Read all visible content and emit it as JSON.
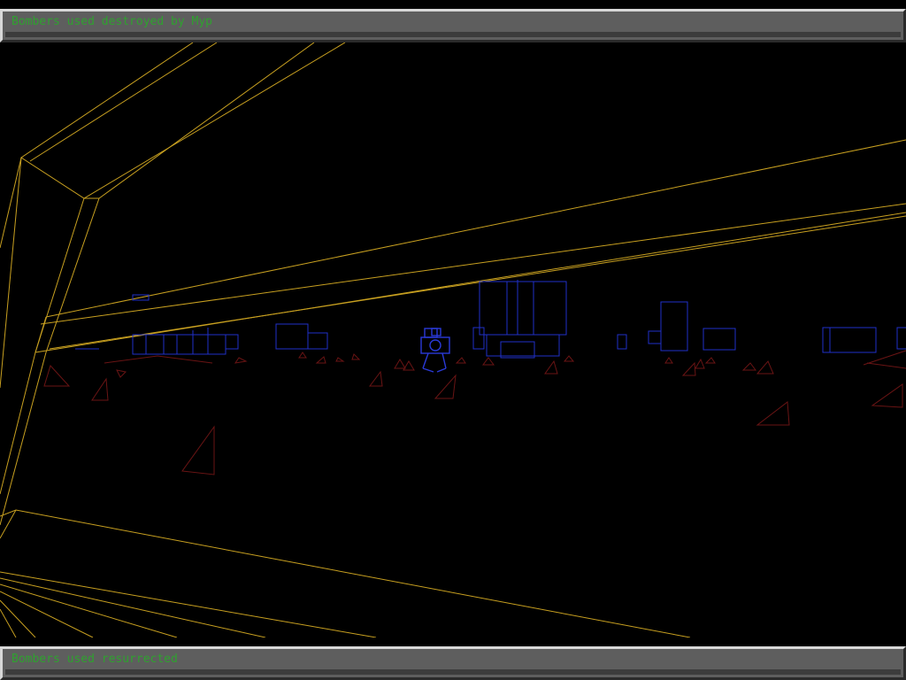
{
  "hud": {
    "top_message": "Bombers used destroyed by Myp",
    "bottom_message": "Bombers used resurrected"
  },
  "colors": {
    "background": "#000000",
    "wall_wireframe": "#c8a020",
    "building_wireframe": "#2030c8",
    "marker_wireframe": "#6a1414",
    "enemy_wireframe": "#2a3ad8",
    "hud_panel": "#5e5e5e",
    "hud_text": "#2fa12f"
  },
  "scene": {
    "view": "first-person wireframe arena",
    "walls": "yellow-wireframe-walls",
    "structures": "blue-wireframe-buildings",
    "markers": "red-triangle-markers",
    "enemy": "blue-wireframe-mech"
  }
}
